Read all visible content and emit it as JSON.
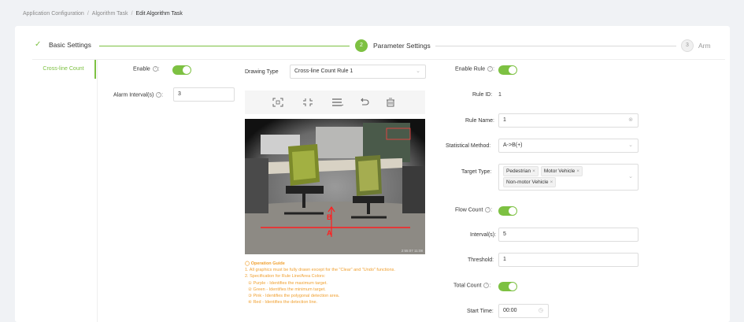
{
  "breadcrumb": {
    "items": [
      "Application Configuration",
      "Algorithm Task",
      "Edit Algorithm Task"
    ],
    "separator": "/"
  },
  "steps": [
    {
      "label": "Basic Settings",
      "state": "done"
    },
    {
      "number": "2",
      "label": "Parameter Settings",
      "state": "active"
    },
    {
      "number": "3",
      "label": "Arm",
      "state": "pending"
    }
  ],
  "sidebar": {
    "items": [
      {
        "label": "Cross-line Count",
        "active": true
      }
    ]
  },
  "left_form": {
    "enable_label": "Enable",
    "enable_on": true,
    "alarm_interval_label": "Alarm Interval(s)",
    "alarm_interval_value": "3"
  },
  "drawing": {
    "type_label": "Drawing Type",
    "type_value": "Cross-line Count Rule 1",
    "tools": [
      "maximize-target-icon",
      "minimize-target-icon",
      "menu-lines-icon",
      "undo-icon",
      "clear-icon"
    ],
    "camera_timestamp": "2:55:07 11:08"
  },
  "guide": {
    "title": "Operation Guide",
    "lines": [
      "1. All graphics must be fully drawn except for the \"Clear\" and \"Undo\" functions.",
      "2. Specification for Rule Line/Area Colors:",
      "① Purple - Identifies the maximum target.",
      "② Green - Identifies the minimum target.",
      "③ Pink - Identifies the polygonal detection area.",
      "④ Red - Identifies the detection line."
    ]
  },
  "rule_form": {
    "enable_rule_label": "Enable Rule",
    "enable_rule_on": true,
    "rule_id_label": "Rule ID",
    "rule_id_value": "1",
    "rule_name_label": "Rule Name",
    "rule_name_value": "1",
    "stat_method_label": "Statistical Method",
    "stat_method_value": "A->B(+)",
    "target_type_label": "Target Type",
    "target_types": [
      "Pedestrian",
      "Motor Vehicle",
      "Non-motor Vehicle"
    ],
    "flow_count_label": "Flow Count",
    "flow_count_on": true,
    "interval_label": "Interval(s)",
    "interval_value": "5",
    "threshold_label": "Threshold",
    "threshold_value": "1",
    "total_count_label": "Total Count",
    "total_count_on": true,
    "start_time_label": "Start Time",
    "start_time_value": "00:00"
  },
  "colors": {
    "accent": "#7dc142",
    "guide": "#f0a030",
    "detection_line": "#ff2020"
  }
}
